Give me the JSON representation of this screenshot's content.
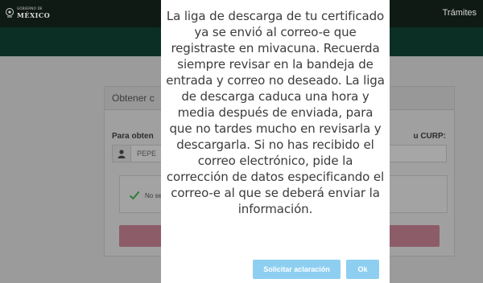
{
  "header": {
    "logo_top": "GOBIERNO DE",
    "logo_main": "MÉXICO",
    "nav_link": "Trámites"
  },
  "card": {
    "title": "Obtener c",
    "label_left": "Para obten",
    "label_right": "u CURP:",
    "input_value": "PEPE",
    "alert_text": "No se"
  },
  "modal": {
    "message": "La liga de descarga de tu certificado ya se envió al correo-e que registraste en mivacuna. Recuerda siempre revisar en la bandeja de entrada y correo no deseado. La liga de descarga caduca una hora y media después de enviada, para que no tardes mucho en revisarla y descargarla. Si no has recibido el correo electrónico, pide la corrección de datos especificando el correo-e al que se deberá enviar la información.",
    "btn_aclaracion": "Solicitar aclaración",
    "btn_ok": "Ok"
  },
  "colors": {
    "header_bg": "#0f1a14",
    "greenbar_bg": "#0c2f25",
    "accent_button": "#8ecff1",
    "submit_button": "#8d5c69"
  },
  "icons": [
    "mexico-emblem-icon",
    "user-icon",
    "check-icon"
  ]
}
